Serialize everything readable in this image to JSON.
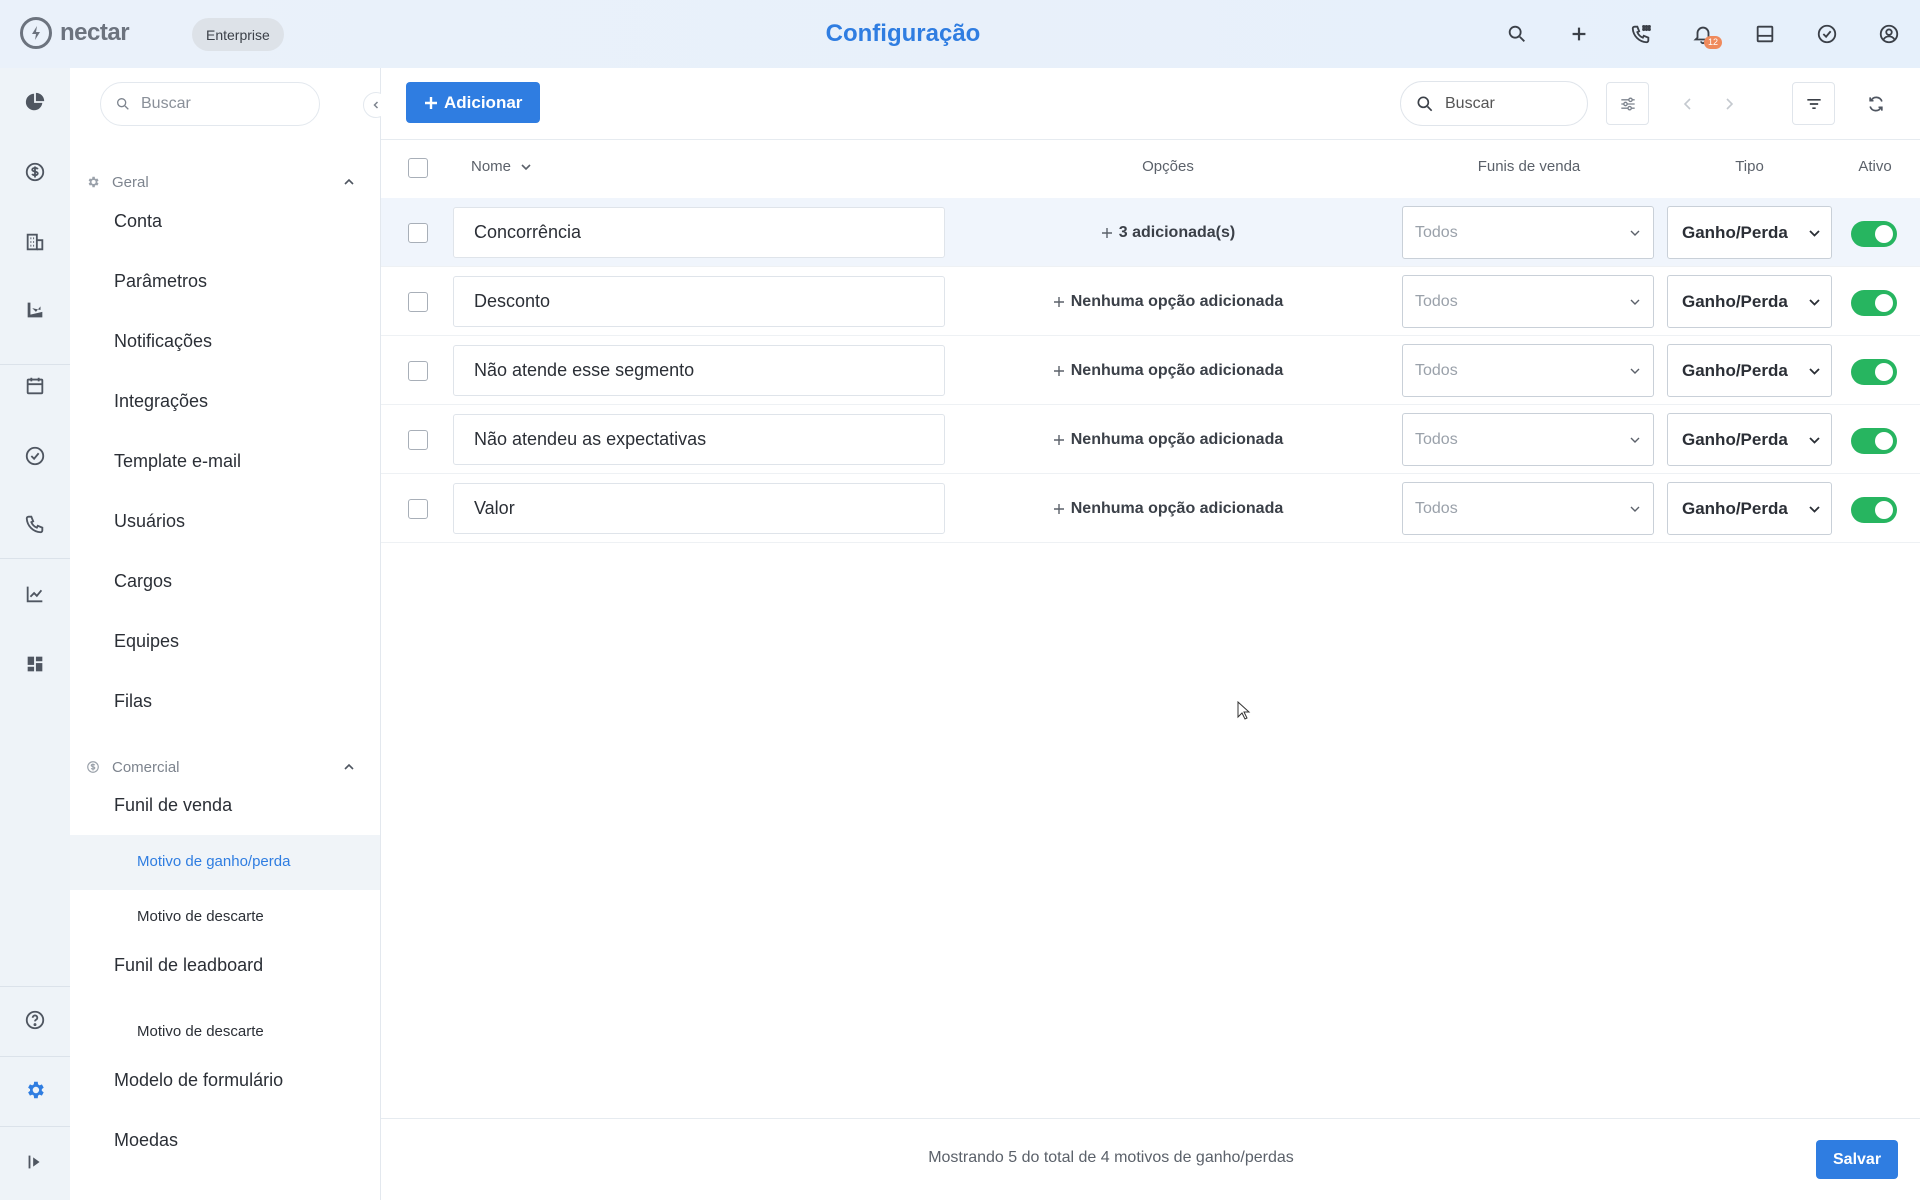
{
  "app": {
    "logo_text": "nectar",
    "plan_badge": "Enterprise",
    "page_title": "Configuração",
    "notification_count": "12",
    "brand_color": "#2f7de1"
  },
  "sidebar": {
    "search_placeholder": "Buscar",
    "sections": [
      {
        "title": "Geral",
        "items": [
          "Conta",
          "Parâmetros",
          "Notificações",
          "Integrações",
          "Template e-mail",
          "Usuários",
          "Cargos",
          "Equipes",
          "Filas"
        ]
      },
      {
        "title": "Comercial",
        "items": [
          "Funil de venda",
          "Motivo de ganho/perda",
          "Motivo de descarte",
          "Funil de leadboard",
          "Motivo de descarte",
          "Modelo de formulário",
          "Moedas"
        ]
      }
    ]
  },
  "toolbar": {
    "add_label": "Adicionar",
    "search_placeholder": "Buscar"
  },
  "table": {
    "columns": {
      "name": "Nome",
      "options": "Opções",
      "funnels": "Funis de venda",
      "type": "Tipo",
      "active": "Ativo"
    },
    "rows": [
      {
        "name": "Concorrência",
        "options": "3 adicionada(s)",
        "funnel": "Todos",
        "type": "Ganho/Perda",
        "active": true
      },
      {
        "name": "Desconto",
        "options": "Nenhuma opção adicionada",
        "funnel": "Todos",
        "type": "Ganho/Perda",
        "active": true
      },
      {
        "name": "Não atende esse segmento",
        "options": "Nenhuma opção adicionada",
        "funnel": "Todos",
        "type": "Ganho/Perda",
        "active": true
      },
      {
        "name": "Não atendeu as expectativas",
        "options": "Nenhuma opção adicionada",
        "funnel": "Todos",
        "type": "Ganho/Perda",
        "active": true
      },
      {
        "name": "Valor",
        "options": "Nenhuma opção adicionada",
        "funnel": "Todos",
        "type": "Ganho/Perda",
        "active": true
      }
    ]
  },
  "footer": {
    "status_text": "Mostrando 5 do total de 4 motivos de ganho/perdas",
    "save_label": "Salvar"
  }
}
